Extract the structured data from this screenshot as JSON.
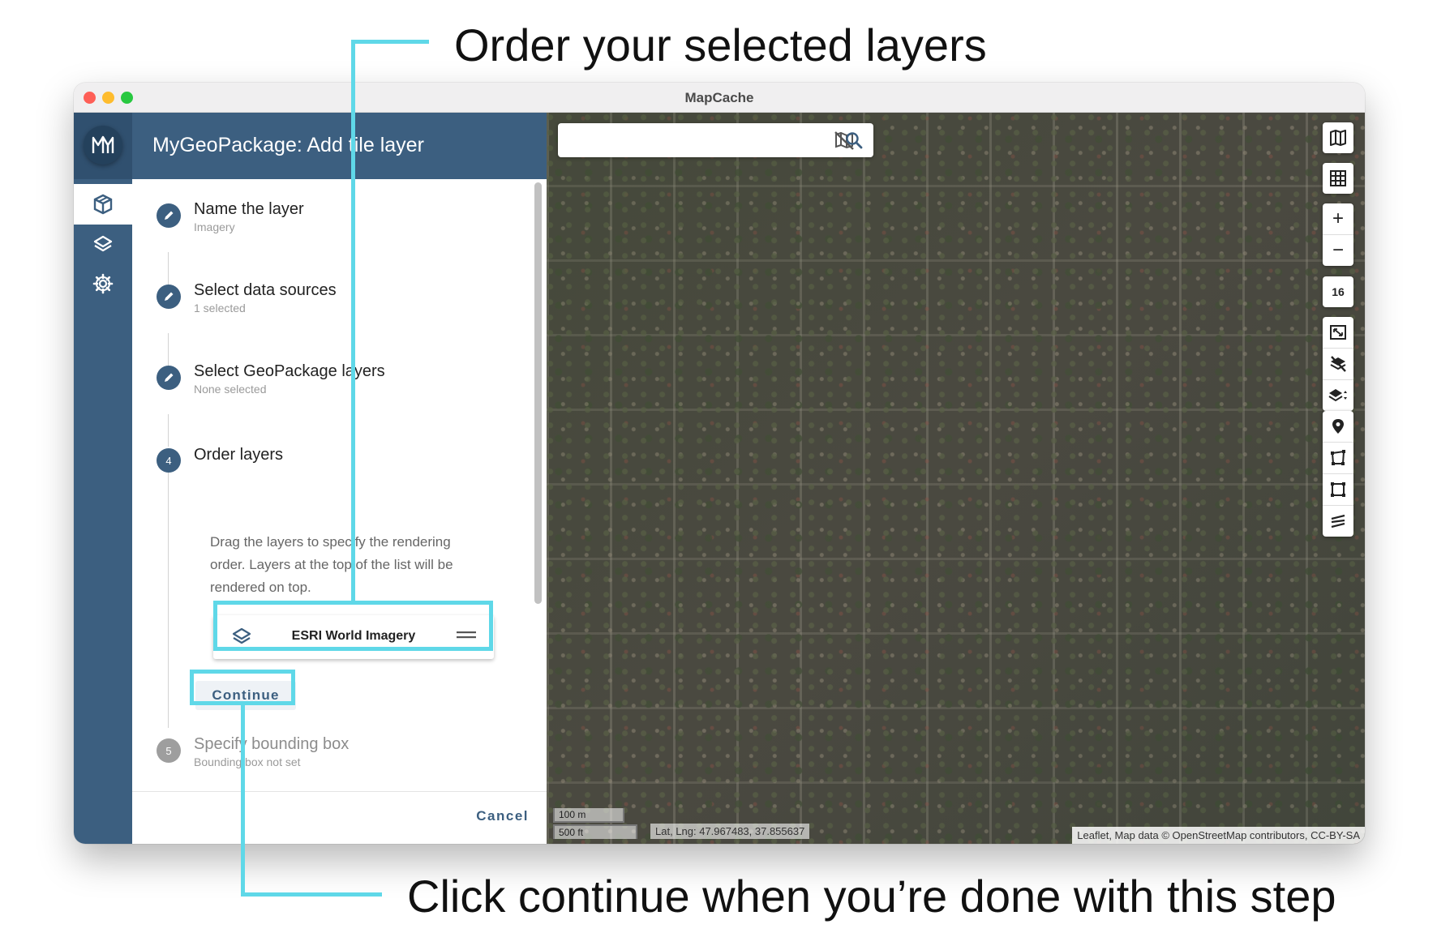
{
  "callouts": {
    "top": "Order your selected layers",
    "bottom": "Click continue when you’re done with this step"
  },
  "window": {
    "title": "MapCache"
  },
  "rail": {
    "items": [
      {
        "icon": "geopackage-icon",
        "active": true
      },
      {
        "icon": "layers-icon",
        "active": false
      },
      {
        "icon": "settings-icon",
        "active": false
      }
    ]
  },
  "panel": {
    "title": "MyGeoPackage: Add tile layer",
    "steps": [
      {
        "number": "1",
        "title": "Name the layer",
        "subtitle": "Imagery",
        "state": "edit"
      },
      {
        "number": "2",
        "title": "Select data sources",
        "subtitle": "1 selected",
        "state": "edit"
      },
      {
        "number": "3",
        "title": "Select GeoPackage layers",
        "subtitle": "None selected",
        "state": "edit"
      },
      {
        "number": "4",
        "title": "Order layers",
        "subtitle": "",
        "state": "active"
      },
      {
        "number": "5",
        "title": "Specify bounding box",
        "subtitle": "Bounding box not set",
        "state": "pending"
      }
    ],
    "instructions": "Drag the layers to specify the rendering order. Layers at the top of the list will be rendered on top.",
    "layers": [
      {
        "name": "ESRI World Imagery"
      }
    ],
    "continue_label": "Continue",
    "cancel_label": "Cancel"
  },
  "map": {
    "search": {
      "value": "",
      "placeholder": ""
    },
    "zoom_level": "16",
    "scale_metric": "100 m",
    "scale_imperial": "500 ft",
    "latlng": "Lat, Lng: 47.967483, 37.855637",
    "attribution": "Leaflet, Map data © OpenStreetMap contributors, CC-BY-SA"
  },
  "colors": {
    "primary": "#3c5f80",
    "rail_dark": "#30506f",
    "highlight": "#5fd8e8"
  }
}
